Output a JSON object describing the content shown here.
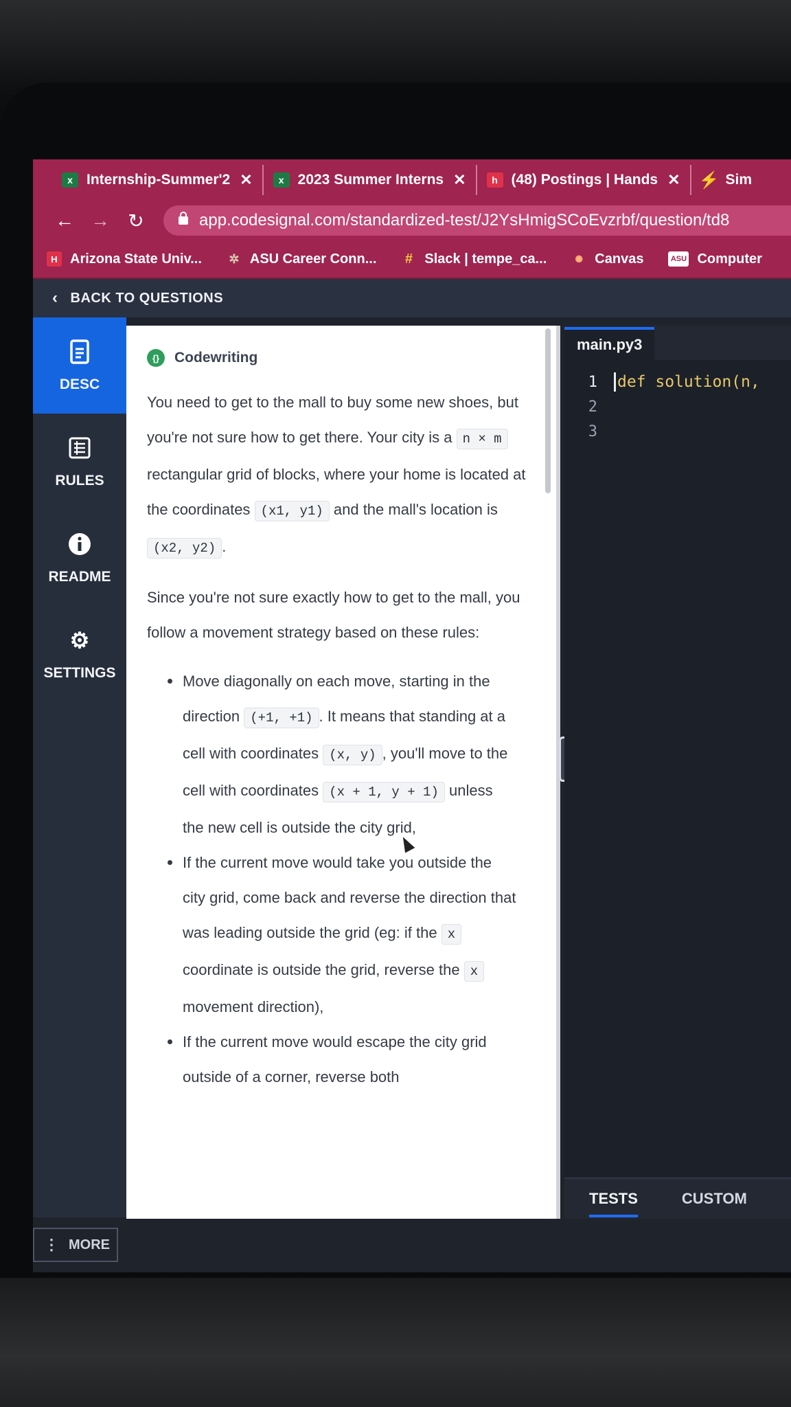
{
  "browser": {
    "tabs": [
      {
        "label": "Internship-Summer'2",
        "icon": "sheets-icon",
        "closable": true
      },
      {
        "label": "2023 Summer Interns",
        "icon": "sheets-icon",
        "closable": true
      },
      {
        "label": "(48) Postings | Hands",
        "icon": "handshake-icon",
        "closable": true
      },
      {
        "label": "Sim",
        "icon": "lightning-icon",
        "closable": false
      }
    ],
    "url": "app.codesignal.com/standardized-test/J2YsHmigSCoEvzrbf/question/td8",
    "bookmarks": [
      {
        "label": "Arizona State Univ...",
        "icon": "H"
      },
      {
        "label": "ASU Career Conn...",
        "icon": "✲"
      },
      {
        "label": "Slack | tempe_ca...",
        "icon": "#"
      },
      {
        "label": "Canvas",
        "icon": "✺"
      },
      {
        "label": "Computer",
        "icon": "ASU"
      }
    ],
    "theme_color": "#9f2450"
  },
  "app": {
    "back_label": "BACK TO QUESTIONS",
    "sidebar": [
      {
        "label": "DESC",
        "icon": "document-icon",
        "active": true
      },
      {
        "label": "RULES",
        "icon": "list-icon",
        "active": false
      },
      {
        "label": "README",
        "icon": "info-icon",
        "active": false
      },
      {
        "label": "SETTINGS",
        "icon": "gear-icon",
        "active": false
      }
    ],
    "more_label": "MORE",
    "accent_color": "#1565e0"
  },
  "description": {
    "type_label": "Codewriting",
    "p1": {
      "t1": "You need to get to the mall to buy some new shoes, but you're not sure how to get there. Your city is a ",
      "c1": "n × m",
      "t2": " rectangular grid of blocks, where your home is located at the coordinates ",
      "c2": "(x1, y1)",
      "t3": " and the mall's location is ",
      "c3": "(x2, y2)",
      "t4": "."
    },
    "p2": "Since you're not sure exactly how to get to the mall, you follow a movement strategy based on these rules:",
    "rule1": {
      "t1": "Move diagonally on each move, starting in the direction ",
      "c1": "(+1, +1)",
      "t2": ". It means that standing at a cell with coordinates ",
      "c2": "(x, y)",
      "t3": ", you'll move to the cell with coordinates ",
      "c3": "(x + 1, y + 1)",
      "t4": " unless the new cell is outside the city grid,"
    },
    "rule2": {
      "t1": "If the current move would take you outside the city grid, come back and reverse the direction that was leading outside the grid (eg: if the ",
      "c1": "x",
      "t2": " coordinate is outside the grid, reverse the ",
      "c2": "x",
      "t3": " movement direction),"
    },
    "rule3": "If the current move would escape the city grid outside of a corner, reverse both"
  },
  "editor": {
    "filename": "main.py3",
    "lines": [
      {
        "no": "1",
        "code": "def solution(n,"
      },
      {
        "no": "2",
        "code": ""
      },
      {
        "no": "3",
        "code": ""
      }
    ],
    "tests_label": "TESTS",
    "custom_label": "CUSTOM"
  }
}
